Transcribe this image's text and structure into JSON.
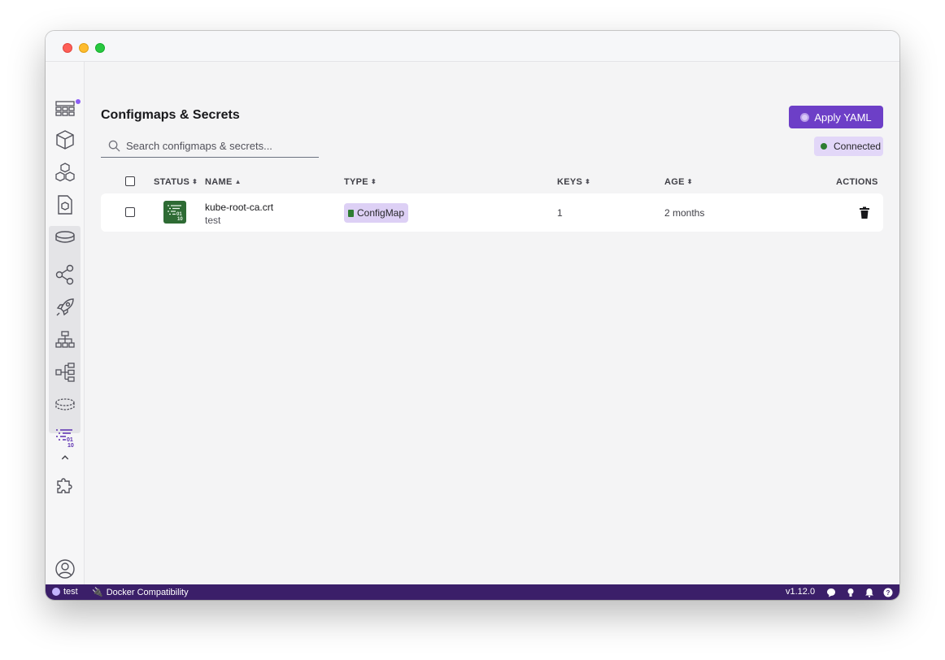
{
  "page": {
    "title": "Configmaps & Secrets",
    "apply_button": "Apply YAML",
    "search_placeholder": "Search configmaps & secrets...",
    "connection_status": "Connected"
  },
  "sidebar": {
    "items": [
      {
        "icon": "dashboard-icon"
      },
      {
        "icon": "containers-icon"
      },
      {
        "icon": "pods-icon"
      },
      {
        "icon": "images-icon"
      },
      {
        "icon": "volumes-icon"
      },
      {
        "icon": "network-icon"
      },
      {
        "icon": "deployments-icon"
      },
      {
        "icon": "services-icon"
      },
      {
        "icon": "ingresses-icon"
      },
      {
        "icon": "pvc-icon"
      },
      {
        "icon": "configmaps-secrets-icon"
      },
      {
        "icon": "extensions-icon"
      },
      {
        "icon": "account-icon"
      },
      {
        "icon": "settings-icon"
      }
    ]
  },
  "table": {
    "columns": [
      "STATUS",
      "NAME",
      "TYPE",
      "KEYS",
      "AGE",
      "ACTIONS"
    ],
    "rows": [
      {
        "name": "kube-root-ca.crt",
        "namespace": "test",
        "type": "ConfigMap",
        "keys": "1",
        "age": "2 months"
      }
    ]
  },
  "statusbar": {
    "context": "test",
    "compat": "Docker Compatibility",
    "version": "v1.12.0"
  },
  "colors": {
    "accent": "#6d3fc7",
    "statusbar": "#3b1f69",
    "connected_dot": "#2e7d32",
    "status_icon": "#2e6b34"
  }
}
